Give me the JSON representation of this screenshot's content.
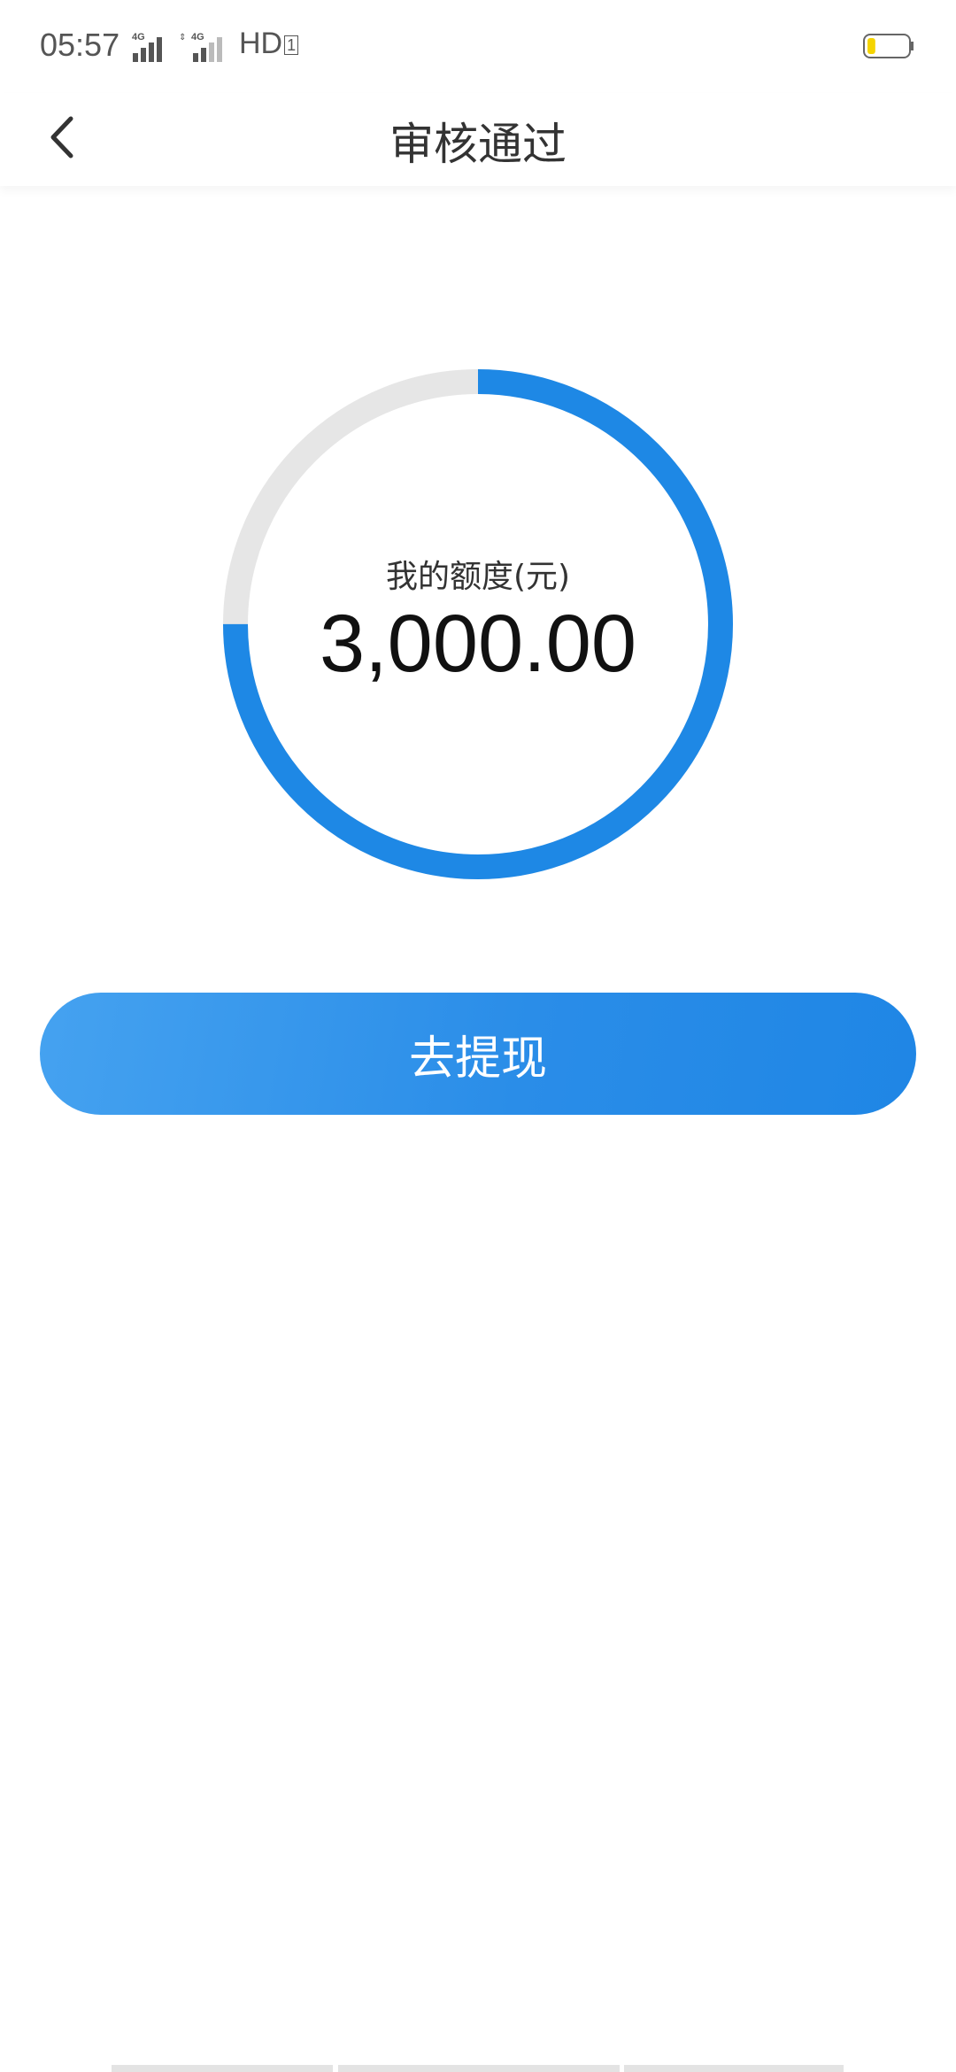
{
  "status_bar": {
    "time": "05:57",
    "network_label": "HD",
    "battery_level": 0.2
  },
  "nav": {
    "title": "审核通过"
  },
  "credit": {
    "label": "我的额度(元)",
    "amount": "3,000.00",
    "ring_progress": 0.75,
    "ring_color": "#1e88e5",
    "ring_track_color": "#e6e6e6"
  },
  "actions": {
    "withdraw_label": "去提现"
  }
}
